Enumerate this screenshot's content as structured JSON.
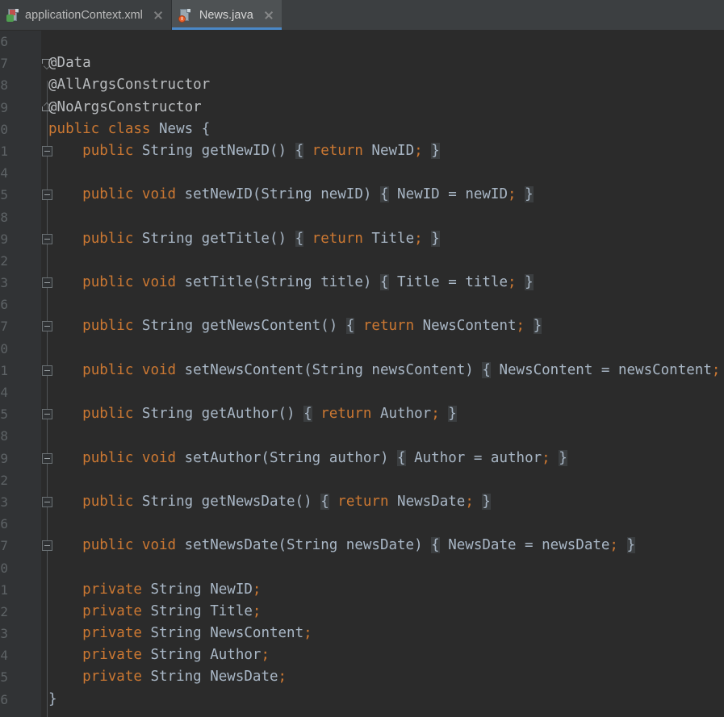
{
  "window": {
    "title": "News.java",
    "background_color": "#2b2b2b",
    "gutter_color": "#313335",
    "tabbar_color": "#3c3f41",
    "accent_color": "#4a88c7",
    "keyword_color": "#cc7832",
    "text_color": "#a9b7c6"
  },
  "tabs": [
    {
      "label": "applicationContext.xml",
      "icon": "xml-file-icon",
      "active": false,
      "close_label": "×"
    },
    {
      "label": "News.java",
      "icon": "java-class-file-icon",
      "active": true,
      "close_label": "×"
    }
  ],
  "editor": {
    "language": "java",
    "lines": [
      {
        "num": "6",
        "fold": "none",
        "tokens": []
      },
      {
        "num": "7",
        "fold": "arrowdown",
        "tokens": [
          {
            "t": "@Data",
            "c": "annw"
          }
        ]
      },
      {
        "num": "8",
        "fold": "none",
        "tokens": [
          {
            "t": "@AllArgsConstructor",
            "c": "annw"
          }
        ]
      },
      {
        "num": "9",
        "fold": "arrowup",
        "tokens": [
          {
            "t": "@NoArgsConstructor",
            "c": "annw"
          }
        ]
      },
      {
        "num": "0",
        "fold": "none",
        "tokens": [
          {
            "t": "public",
            "c": "kw"
          },
          {
            "t": " ",
            "c": "punc"
          },
          {
            "t": "class",
            "c": "kw"
          },
          {
            "t": " ",
            "c": "punc"
          },
          {
            "t": "News",
            "c": "def"
          },
          {
            "t": " ",
            "c": "punc"
          },
          {
            "t": "{",
            "c": "punc"
          }
        ]
      },
      {
        "num": "1",
        "fold": "box",
        "tokens": [
          {
            "t": "    ",
            "c": "punc"
          },
          {
            "t": "public",
            "c": "kw"
          },
          {
            "t": " ",
            "c": "punc"
          },
          {
            "t": "String",
            "c": "def"
          },
          {
            "t": " getNewID() ",
            "c": "def"
          },
          {
            "t": "{",
            "c": "brace"
          },
          {
            "t": " ",
            "c": "punc"
          },
          {
            "t": "return",
            "c": "kw"
          },
          {
            "t": " NewID",
            "c": "def"
          },
          {
            "t": ";",
            "c": "semi"
          },
          {
            "t": " ",
            "c": "punc"
          },
          {
            "t": "}",
            "c": "brace"
          }
        ]
      },
      {
        "num": "4",
        "fold": "none",
        "tokens": []
      },
      {
        "num": "5",
        "fold": "box",
        "tokens": [
          {
            "t": "    ",
            "c": "punc"
          },
          {
            "t": "public",
            "c": "kw"
          },
          {
            "t": " ",
            "c": "punc"
          },
          {
            "t": "void",
            "c": "kw"
          },
          {
            "t": " setNewID(String newID) ",
            "c": "def"
          },
          {
            "t": "{",
            "c": "brace"
          },
          {
            "t": " NewID = newID",
            "c": "def"
          },
          {
            "t": ";",
            "c": "semi"
          },
          {
            "t": " ",
            "c": "punc"
          },
          {
            "t": "}",
            "c": "brace"
          }
        ]
      },
      {
        "num": "8",
        "fold": "none",
        "tokens": []
      },
      {
        "num": "9",
        "fold": "box",
        "tokens": [
          {
            "t": "    ",
            "c": "punc"
          },
          {
            "t": "public",
            "c": "kw"
          },
          {
            "t": " ",
            "c": "punc"
          },
          {
            "t": "String",
            "c": "def"
          },
          {
            "t": " getTitle() ",
            "c": "def"
          },
          {
            "t": "{",
            "c": "brace"
          },
          {
            "t": " ",
            "c": "punc"
          },
          {
            "t": "return",
            "c": "kw"
          },
          {
            "t": " Title",
            "c": "def"
          },
          {
            "t": ";",
            "c": "semi"
          },
          {
            "t": " ",
            "c": "punc"
          },
          {
            "t": "}",
            "c": "brace"
          }
        ]
      },
      {
        "num": "2",
        "fold": "none",
        "tokens": []
      },
      {
        "num": "3",
        "fold": "box",
        "tokens": [
          {
            "t": "    ",
            "c": "punc"
          },
          {
            "t": "public",
            "c": "kw"
          },
          {
            "t": " ",
            "c": "punc"
          },
          {
            "t": "void",
            "c": "kw"
          },
          {
            "t": " setTitle(String title) ",
            "c": "def"
          },
          {
            "t": "{",
            "c": "brace"
          },
          {
            "t": " Title = title",
            "c": "def"
          },
          {
            "t": ";",
            "c": "semi"
          },
          {
            "t": " ",
            "c": "punc"
          },
          {
            "t": "}",
            "c": "brace"
          }
        ]
      },
      {
        "num": "6",
        "fold": "none",
        "tokens": []
      },
      {
        "num": "7",
        "fold": "box",
        "tokens": [
          {
            "t": "    ",
            "c": "punc"
          },
          {
            "t": "public",
            "c": "kw"
          },
          {
            "t": " ",
            "c": "punc"
          },
          {
            "t": "String",
            "c": "def"
          },
          {
            "t": " getNewsContent() ",
            "c": "def"
          },
          {
            "t": "{",
            "c": "brace"
          },
          {
            "t": " ",
            "c": "punc"
          },
          {
            "t": "return",
            "c": "kw"
          },
          {
            "t": " NewsContent",
            "c": "def"
          },
          {
            "t": ";",
            "c": "semi"
          },
          {
            "t": " ",
            "c": "punc"
          },
          {
            "t": "}",
            "c": "brace"
          }
        ]
      },
      {
        "num": "0",
        "fold": "none",
        "tokens": []
      },
      {
        "num": "1",
        "fold": "box",
        "tokens": [
          {
            "t": "    ",
            "c": "punc"
          },
          {
            "t": "public",
            "c": "kw"
          },
          {
            "t": " ",
            "c": "punc"
          },
          {
            "t": "void",
            "c": "kw"
          },
          {
            "t": " setNewsContent(String newsContent) ",
            "c": "def"
          },
          {
            "t": "{",
            "c": "brace"
          },
          {
            "t": " NewsContent = newsContent",
            "c": "def"
          },
          {
            "t": ";",
            "c": "semi"
          },
          {
            "t": " ",
            "c": "punc"
          },
          {
            "t": "}",
            "c": "brace"
          }
        ]
      },
      {
        "num": "4",
        "fold": "none",
        "tokens": []
      },
      {
        "num": "5",
        "fold": "box",
        "tokens": [
          {
            "t": "    ",
            "c": "punc"
          },
          {
            "t": "public",
            "c": "kw"
          },
          {
            "t": " ",
            "c": "punc"
          },
          {
            "t": "String",
            "c": "def"
          },
          {
            "t": " getAuthor() ",
            "c": "def"
          },
          {
            "t": "{",
            "c": "brace"
          },
          {
            "t": " ",
            "c": "punc"
          },
          {
            "t": "return",
            "c": "kw"
          },
          {
            "t": " Author",
            "c": "def"
          },
          {
            "t": ";",
            "c": "semi"
          },
          {
            "t": " ",
            "c": "punc"
          },
          {
            "t": "}",
            "c": "brace"
          }
        ]
      },
      {
        "num": "8",
        "fold": "none",
        "tokens": []
      },
      {
        "num": "9",
        "fold": "box",
        "tokens": [
          {
            "t": "    ",
            "c": "punc"
          },
          {
            "t": "public",
            "c": "kw"
          },
          {
            "t": " ",
            "c": "punc"
          },
          {
            "t": "void",
            "c": "kw"
          },
          {
            "t": " setAuthor(String author) ",
            "c": "def"
          },
          {
            "t": "{",
            "c": "brace"
          },
          {
            "t": " Author = author",
            "c": "def"
          },
          {
            "t": ";",
            "c": "semi"
          },
          {
            "t": " ",
            "c": "punc"
          },
          {
            "t": "}",
            "c": "brace"
          }
        ]
      },
      {
        "num": "2",
        "fold": "none",
        "tokens": []
      },
      {
        "num": "3",
        "fold": "box",
        "tokens": [
          {
            "t": "    ",
            "c": "punc"
          },
          {
            "t": "public",
            "c": "kw"
          },
          {
            "t": " ",
            "c": "punc"
          },
          {
            "t": "String",
            "c": "def"
          },
          {
            "t": " getNewsDate() ",
            "c": "def"
          },
          {
            "t": "{",
            "c": "brace"
          },
          {
            "t": " ",
            "c": "punc"
          },
          {
            "t": "return",
            "c": "kw"
          },
          {
            "t": " NewsDate",
            "c": "def"
          },
          {
            "t": ";",
            "c": "semi"
          },
          {
            "t": " ",
            "c": "punc"
          },
          {
            "t": "}",
            "c": "brace"
          }
        ]
      },
      {
        "num": "6",
        "fold": "none",
        "tokens": []
      },
      {
        "num": "7",
        "fold": "box",
        "tokens": [
          {
            "t": "    ",
            "c": "punc"
          },
          {
            "t": "public",
            "c": "kw"
          },
          {
            "t": " ",
            "c": "punc"
          },
          {
            "t": "void",
            "c": "kw"
          },
          {
            "t": " setNewsDate(String newsDate) ",
            "c": "def"
          },
          {
            "t": "{",
            "c": "brace"
          },
          {
            "t": " NewsDate = newsDate",
            "c": "def"
          },
          {
            "t": ";",
            "c": "semi"
          },
          {
            "t": " ",
            "c": "punc"
          },
          {
            "t": "}",
            "c": "brace"
          }
        ]
      },
      {
        "num": "0",
        "fold": "none",
        "tokens": []
      },
      {
        "num": "1",
        "fold": "none",
        "tokens": [
          {
            "t": "    ",
            "c": "punc"
          },
          {
            "t": "private",
            "c": "kw"
          },
          {
            "t": " ",
            "c": "punc"
          },
          {
            "t": "String",
            "c": "def"
          },
          {
            "t": " NewID",
            "c": "def"
          },
          {
            "t": ";",
            "c": "semi"
          }
        ]
      },
      {
        "num": "2",
        "fold": "none",
        "tokens": [
          {
            "t": "    ",
            "c": "punc"
          },
          {
            "t": "private",
            "c": "kw"
          },
          {
            "t": " ",
            "c": "punc"
          },
          {
            "t": "String",
            "c": "def"
          },
          {
            "t": " Title",
            "c": "def"
          },
          {
            "t": ";",
            "c": "semi"
          }
        ]
      },
      {
        "num": "3",
        "fold": "none",
        "tokens": [
          {
            "t": "    ",
            "c": "punc"
          },
          {
            "t": "private",
            "c": "kw"
          },
          {
            "t": " ",
            "c": "punc"
          },
          {
            "t": "String",
            "c": "def"
          },
          {
            "t": " NewsContent",
            "c": "def"
          },
          {
            "t": ";",
            "c": "semi"
          }
        ]
      },
      {
        "num": "4",
        "fold": "none",
        "tokens": [
          {
            "t": "    ",
            "c": "punc"
          },
          {
            "t": "private",
            "c": "kw"
          },
          {
            "t": " ",
            "c": "punc"
          },
          {
            "t": "String",
            "c": "def"
          },
          {
            "t": " Author",
            "c": "def"
          },
          {
            "t": ";",
            "c": "semi"
          }
        ]
      },
      {
        "num": "5",
        "fold": "none",
        "tokens": [
          {
            "t": "    ",
            "c": "punc"
          },
          {
            "t": "private",
            "c": "kw"
          },
          {
            "t": " ",
            "c": "punc"
          },
          {
            "t": "String",
            "c": "def"
          },
          {
            "t": " NewsDate",
            "c": "def"
          },
          {
            "t": ";",
            "c": "semi"
          }
        ]
      },
      {
        "num": "6",
        "fold": "none",
        "tokens": [
          {
            "t": "}",
            "c": "punc"
          }
        ]
      }
    ]
  }
}
